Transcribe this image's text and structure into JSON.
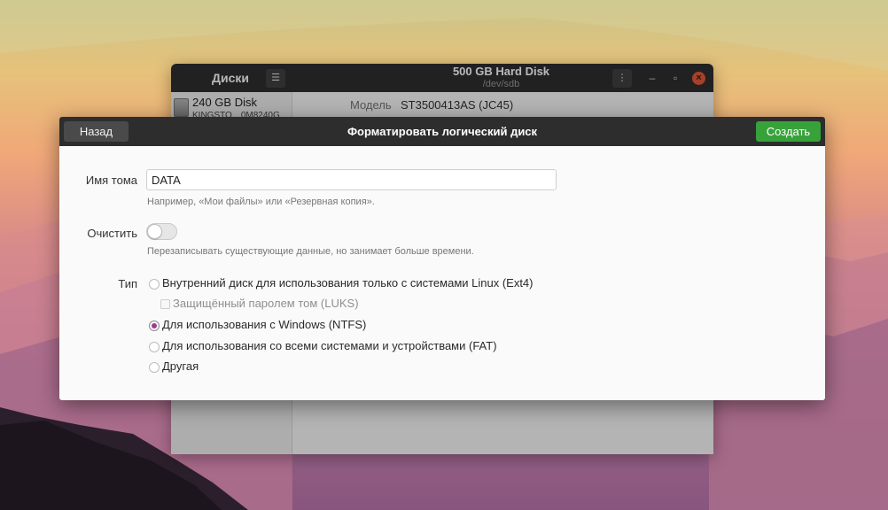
{
  "disks_window": {
    "app_title": "Диски",
    "menu_icon": "hamburger-menu-icon",
    "disk_title": "500 GB Hard Disk",
    "disk_subtitle": "/dev/sdb",
    "sidebar": {
      "items": [
        {
          "name": "240 GB Disk",
          "model": "KINGSTO…0M8240G"
        }
      ]
    },
    "model_label": "Модель",
    "model_value": "ST3500413AS (JC45)"
  },
  "dialog": {
    "title": "Форматировать логический диск",
    "back_label": "Назад",
    "create_label": "Создать",
    "volume_name": {
      "label": "Имя тома",
      "value": "DATA",
      "hint": "Например, «Мои файлы» или «Резервная копия»."
    },
    "erase": {
      "label": "Очистить",
      "enabled": false,
      "hint": "Перезаписывать существующие данные, но занимает больше времени."
    },
    "type": {
      "label": "Тип",
      "options": [
        {
          "label": "Внутренний диск для использования только с системами Linux (Ext4)",
          "checked": false
        },
        {
          "label": "Для использования с Windows (NTFS)",
          "checked": true
        },
        {
          "label": "Для использования со всеми системами и устройствами (FAT)",
          "checked": false
        },
        {
          "label": "Другая",
          "checked": false
        }
      ],
      "luks_label": "Защищённый паролем том (LUKS)",
      "luks_checked": false
    }
  },
  "colors": {
    "accent_create": "#37a23a",
    "radio_selected": "#9b3b91",
    "header_dark": "#2d2d2d"
  }
}
